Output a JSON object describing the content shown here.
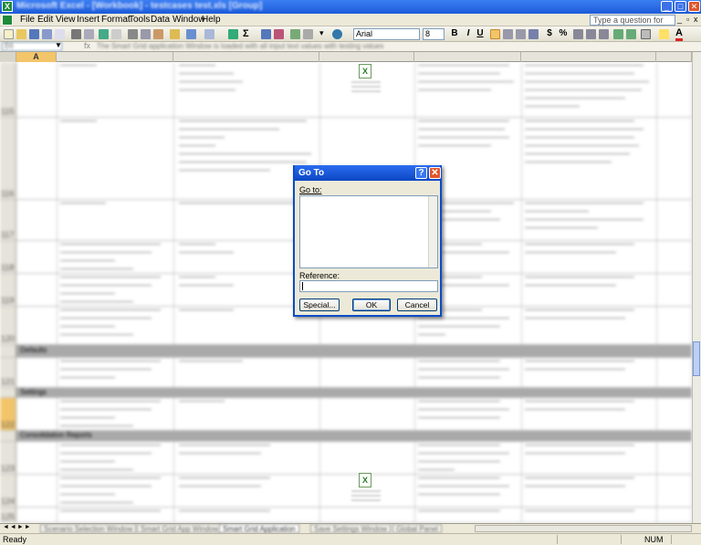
{
  "window": {
    "title": "Microsoft Excel - [Workbook] - testcases test.xls [Group]"
  },
  "help": {
    "placeholder": "Type a question for help"
  },
  "menu": [
    "File",
    "Edit",
    "View",
    "Insert",
    "Format",
    "Tools",
    "Data",
    "Window",
    "Help"
  ],
  "toolbar": {
    "font": "Arial",
    "size": "8",
    "bold": "B",
    "italic": "I",
    "underline": "U",
    "currency": "$",
    "percent": "%"
  },
  "formula_bar": {
    "name": "B6",
    "fx": "fx",
    "content": "The Smart Grid application Window is loaded with all input text values with testing values"
  },
  "columns": [
    "A"
  ],
  "rows": [
    {
      "num": "115"
    },
    {
      "num": "116"
    },
    {
      "num": "117"
    },
    {
      "num": "118"
    },
    {
      "num": "119"
    },
    {
      "num": "120"
    },
    {
      "num": "121"
    },
    {
      "num": "122"
    },
    {
      "num": "123"
    },
    {
      "num": "124"
    },
    {
      "num": "125"
    },
    {
      "num": "126"
    }
  ],
  "grid_text": {
    "section1": "Defaults",
    "section2": "Settings",
    "section3": "Consolidation Reports"
  },
  "sheet_tabs": [
    "Scenario Selection Window",
    "Smart Grid App Window",
    "Smart Grid Application",
    "Save Settings Window",
    "Global Panel"
  ],
  "status": {
    "ready": "Ready",
    "num": "NUM"
  },
  "dialog": {
    "title": "Go To",
    "help": "?",
    "close": "✕",
    "goto_label": "Go to:",
    "reference_label": "Reference:",
    "reference_value": "",
    "special": "Special...",
    "ok": "OK",
    "cancel": "Cancel"
  },
  "colors": {
    "title_bar": "#1c5bd9",
    "dialog_border": "#0a4cc8",
    "close": "#e0552c"
  }
}
